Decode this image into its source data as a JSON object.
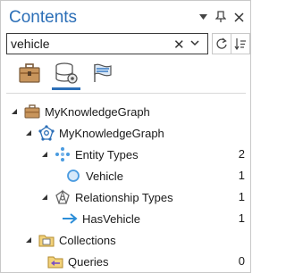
{
  "pane": {
    "title": "Contents",
    "controls": [
      "pin-menu-icon",
      "auto-hide-icon",
      "close-icon"
    ]
  },
  "search": {
    "value": "vehicle",
    "placeholder": ""
  },
  "tabs": [
    {
      "name": "list-by-data-source",
      "icon": "briefcase-icon",
      "active": false
    },
    {
      "name": "list-by-type",
      "icon": "database-gear-icon",
      "active": true
    },
    {
      "name": "list-by-role",
      "icon": "flag-icon",
      "active": false
    }
  ],
  "tree": {
    "kg_root": {
      "label": "MyKnowledgeGraph"
    },
    "kg_graph": {
      "label": "MyKnowledgeGraph"
    },
    "entity_types": {
      "label": "Entity Types",
      "count": "2"
    },
    "vehicle": {
      "label": "Vehicle",
      "count": "1"
    },
    "relationship_types": {
      "label": "Relationship Types",
      "count": "1"
    },
    "has_vehicle": {
      "label": "HasVehicle",
      "count": "1"
    },
    "collections": {
      "label": "Collections"
    },
    "queries": {
      "label": "Queries",
      "count": "0"
    }
  },
  "colors": {
    "accent": "#2c6fb7",
    "vehicle_circle": "#4a9be0"
  }
}
